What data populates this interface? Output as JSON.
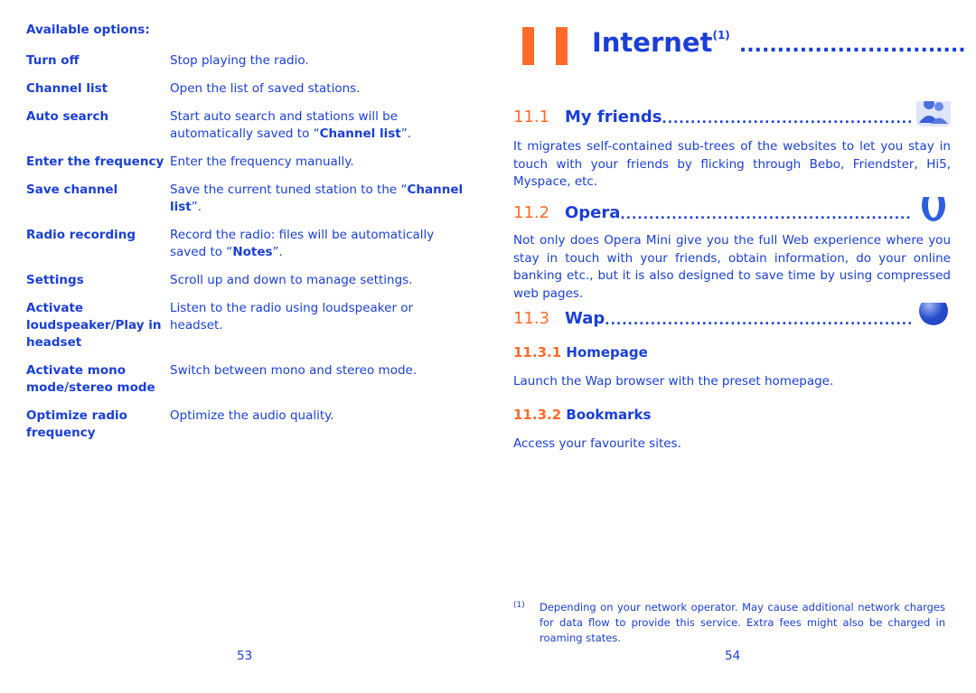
{
  "left_page": {
    "heading": "Available options:",
    "options": [
      {
        "label": "Turn off",
        "desc": "Stop playing the radio."
      },
      {
        "label": "Channel list",
        "desc": "Open the list of saved stations."
      },
      {
        "label": "Auto search",
        "desc_pre": "Start auto search and stations will be automatically saved to “",
        "desc_bold": "Channel list",
        "desc_post": "”."
      },
      {
        "label": "Enter the frequency",
        "desc": "Enter the frequency manually."
      },
      {
        "label": "Save channel",
        "desc_pre": "Save the current tuned station to the “",
        "desc_bold": "Channel list",
        "desc_post": "”."
      },
      {
        "label": "Radio recording",
        "desc_pre": "Record the radio: files will be automatically saved to “",
        "desc_bold": "Notes",
        "desc_post": "”."
      },
      {
        "label": "Settings",
        "desc": "Scroll up and down to manage settings."
      },
      {
        "label": "Activate loudspeaker/Play in headset",
        "desc": "Listen to the radio using loudspeaker or headset."
      },
      {
        "label": "Activate mono mode/stereo mode",
        "desc": "Switch between mono and stereo mode."
      },
      {
        "label": "Optimize radio frequency",
        "desc": "Optimize the audio quality."
      }
    ],
    "page_number": "53"
  },
  "right_page": {
    "chapter_number": "11",
    "chapter_title": "Internet",
    "chapter_footnote_mark": "(1)",
    "sections": [
      {
        "number": "11.1",
        "title": "My friends",
        "icon": "friends-icon",
        "text": "It migrates self-contained sub-trees of the websites to let you stay in touch with your friends by flicking through Bebo, Friendster, Hi5, Myspace, etc."
      },
      {
        "number": "11.2",
        "title": "Opera",
        "icon": "opera-icon",
        "text": "Not only does Opera Mini give you the full Web experience where you stay in touch with your friends, obtain information, do your online banking etc., but it is also designed to save time by using compressed web pages."
      },
      {
        "number": "11.3",
        "title": "Wap",
        "icon": "globe-icon"
      }
    ],
    "subsections": [
      {
        "number": "11.3.1",
        "title": "Homepage",
        "text": "Launch the Wap browser with the preset homepage."
      },
      {
        "number": "11.3.2",
        "title": "Bookmarks",
        "text": "Access your favourite sites."
      }
    ],
    "footnote": {
      "mark": "(1)",
      "text": "Depending on your network operator. May cause additional network charges for data flow to provide this service. Extra fees might also be charged in roaming states."
    },
    "page_number": "54"
  },
  "colors": {
    "text": "#1a3fd6",
    "accent": "#ff6a2b"
  }
}
